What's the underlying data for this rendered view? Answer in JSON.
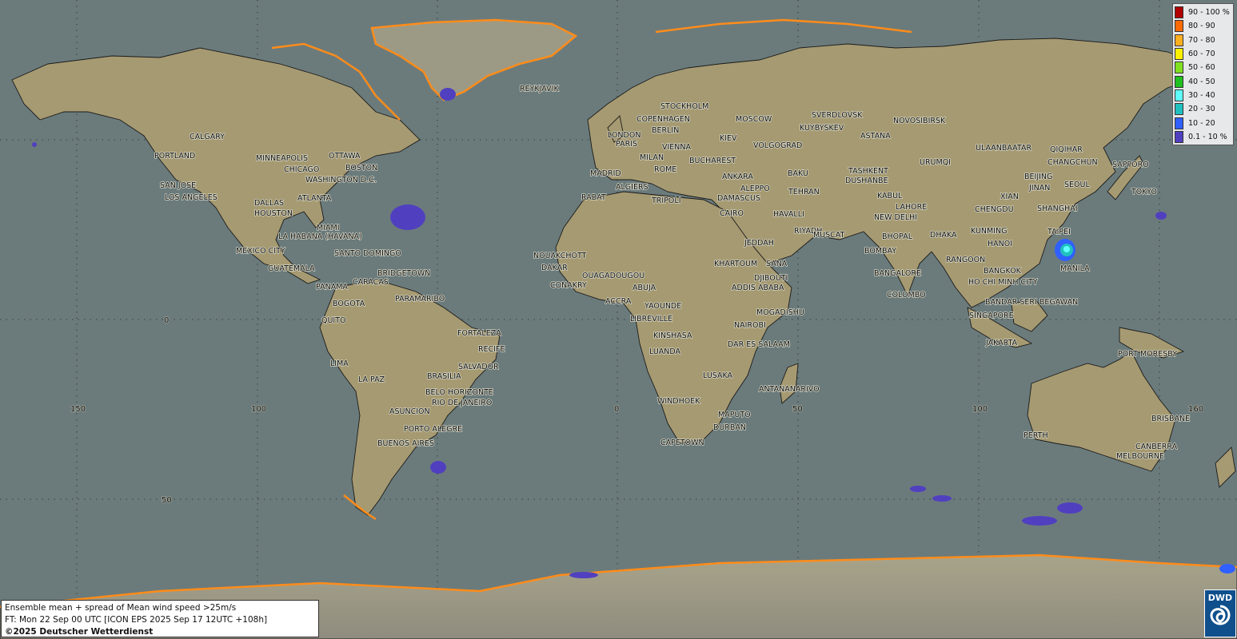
{
  "map": {
    "title": "Ensemble mean + spread of Mean wind speed >25m/s",
    "forecast_time": "FT: Mon 22 Sep 00 UTC [ICON EPS 2025 Sep 17 12UTC +108h]",
    "copyright": "©2025 Deutscher Wetterdienst",
    "logo_text": "DWD",
    "colors": {
      "ocean": "#6b7b7c",
      "land": "#a69a72",
      "ice": "#9a9788",
      "coast_ice": "#ff8c1a"
    },
    "grid_labels": {
      "longitudes": [
        "150",
        "100",
        "0",
        "50",
        "100",
        "160"
      ],
      "latitudes": [
        "0",
        "50"
      ]
    },
    "legend": [
      {
        "label": "90 - 100 %",
        "color": "#b00000"
      },
      {
        "label": "80 - 90",
        "color": "#ff6a00"
      },
      {
        "label": "70 - 80",
        "color": "#ffb020"
      },
      {
        "label": "60 - 70",
        "color": "#fff000"
      },
      {
        "label": "50 - 60",
        "color": "#80e020"
      },
      {
        "label": "40 - 50",
        "color": "#20c020"
      },
      {
        "label": "30 - 40",
        "color": "#60ffff"
      },
      {
        "label": "20 - 30",
        "color": "#20c0c0"
      },
      {
        "label": "10 - 20",
        "color": "#3060ff"
      },
      {
        "label": "0.1 - 10 %",
        "color": "#5040c0"
      }
    ],
    "cities": [
      "REYKJAVIK",
      "STOCKHOLM",
      "COPENHAGEN",
      "MOSCOW",
      "SVERDLOVSK",
      "NOVOSIBIRSK",
      "BERLIN",
      "LONDON",
      "KUYBYSKEV",
      "PARIS",
      "VIENNA",
      "KIEV",
      "ASTANA",
      "VOLGOGRAD",
      "ULAANBAATAR",
      "QIQIHAR",
      "MILAN",
      "BUCHAREST",
      "CHANGCHUN",
      "SAPPORO",
      "CALGARY",
      "MADRID",
      "ROME",
      "ANKARA",
      "BAKU",
      "TASHKENT",
      "URUMQI",
      "PORTLAND",
      "MINNEAPOLIS",
      "OTTAWA",
      "ALGIERS",
      "TEHRAN",
      "DUSHANBE",
      "BEIJING",
      "CHICAGO",
      "BOSTON",
      "ALEPPO",
      "DAMASCUS",
      "KABUL",
      "JINAN",
      "SEOUL",
      "TOKYO",
      "SAN JOSE",
      "WASHINGTON D.C.",
      "RABAT",
      "TRIPOLI",
      "XIAN",
      "LOS ANGELES",
      "ATLANTA",
      "CAIRO",
      "LAHORE",
      "DALLAS",
      "HAVALLI",
      "NEW DELHI",
      "CHENGDU",
      "SHANGHAI",
      "HOUSTON",
      "RIYADH",
      "MUSCAT",
      "MIAMI",
      "DHAKA",
      "KUNMING",
      "TAIPEI",
      "LA HABANA (HAVANA)",
      "JEDDAH",
      "BHOPAL",
      "HANOI",
      "MEXICO CITY",
      "SANTO DOMINGO",
      "NOUAKCHOTT",
      "BOMBAY",
      "KHARTOUM",
      "SANA",
      "RANGOON",
      "GUATEMALA",
      "BRIDGETOWN",
      "DAKAR",
      "OUAGADOUGOU",
      "DJIBOUTI",
      "BANGKOK",
      "MANILA",
      "PANAMA",
      "CARACAS",
      "CONAKRY",
      "ABUJA",
      "ADDIS ABABA",
      "BANGALORE",
      "HO CHI MINH CITY",
      "BOGOTA",
      "ACCRA",
      "YAOUNDE",
      "COLOMBO",
      "PARAMARIBO",
      "MOGADISHU",
      "BANDAR SERI BEGAWAN",
      "QUITO",
      "LIBREVILLE",
      "NAIROBI",
      "SINGAPORE",
      "FORTALEZA",
      "KINSHASA",
      "DAR ES SALAAM",
      "JAKARTA",
      "PORT MORESBY",
      "RECIFE",
      "LUANDA",
      "LIMA",
      "SALVADOR",
      "LUSAKA",
      "BRASILIA",
      "LA PAZ",
      "ANTANANARIVO",
      "BELO HORIZONTE",
      "RIO DE JANEIRO",
      "WINDHOEK",
      "ASUNCION",
      "MAPUTO",
      "BRISBANE",
      "DURBAN",
      "PERTH",
      "PORTO ALEGRE",
      "BUENOS AIRES",
      "CAPETOWN",
      "CANBERRA",
      "MELBOURNE"
    ]
  }
}
